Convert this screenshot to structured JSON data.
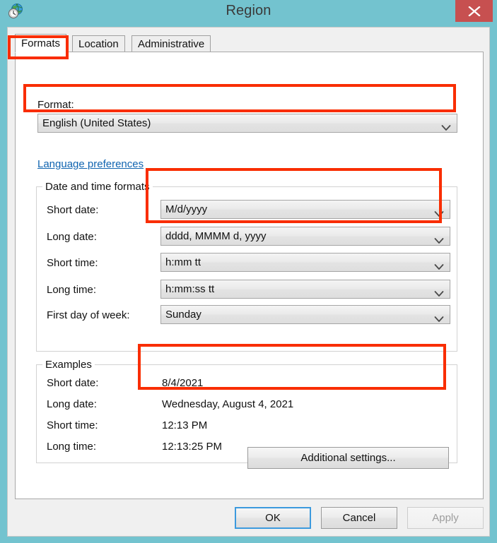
{
  "window": {
    "title": "Region",
    "icon": "region-globe-clock-icon",
    "close_label": "✕",
    "titlebar_color": "#73c3cf",
    "close_button_color": "#c75050"
  },
  "tabs": [
    {
      "id": "formats",
      "label": "Formats",
      "selected": true
    },
    {
      "id": "location",
      "label": "Location",
      "selected": false
    },
    {
      "id": "administrative",
      "label": "Administrative",
      "selected": false
    }
  ],
  "format_section": {
    "label": "Format:",
    "value": "English (United States)"
  },
  "language_preferences_link": "Language preferences",
  "date_time_formats": {
    "group_title": "Date and time formats",
    "rows": [
      {
        "label": "Short date:",
        "value": "M/d/yyyy"
      },
      {
        "label": "Long date:",
        "value": "dddd, MMMM d, yyyy"
      },
      {
        "label": "Short time:",
        "value": "h:mm tt"
      },
      {
        "label": "Long time:",
        "value": "h:mm:ss tt"
      },
      {
        "label": "First day of week:",
        "value": "Sunday"
      }
    ]
  },
  "examples": {
    "group_title": "Examples",
    "rows": [
      {
        "label": "Short date:",
        "value": "8/4/2021"
      },
      {
        "label": "Long date:",
        "value": "Wednesday, August 4, 2021"
      },
      {
        "label": "Short time:",
        "value": "12:13 PM"
      },
      {
        "label": "Long time:",
        "value": "12:13:25 PM"
      }
    ]
  },
  "buttons": {
    "additional_settings": "Additional settings...",
    "ok": "OK",
    "cancel": "Cancel",
    "apply": "Apply"
  },
  "annotations": {
    "color": "#f92d00",
    "boxes": [
      "formats-tab",
      "format-dropdown",
      "short-and-long-date-dropdowns",
      "example-dates"
    ]
  }
}
